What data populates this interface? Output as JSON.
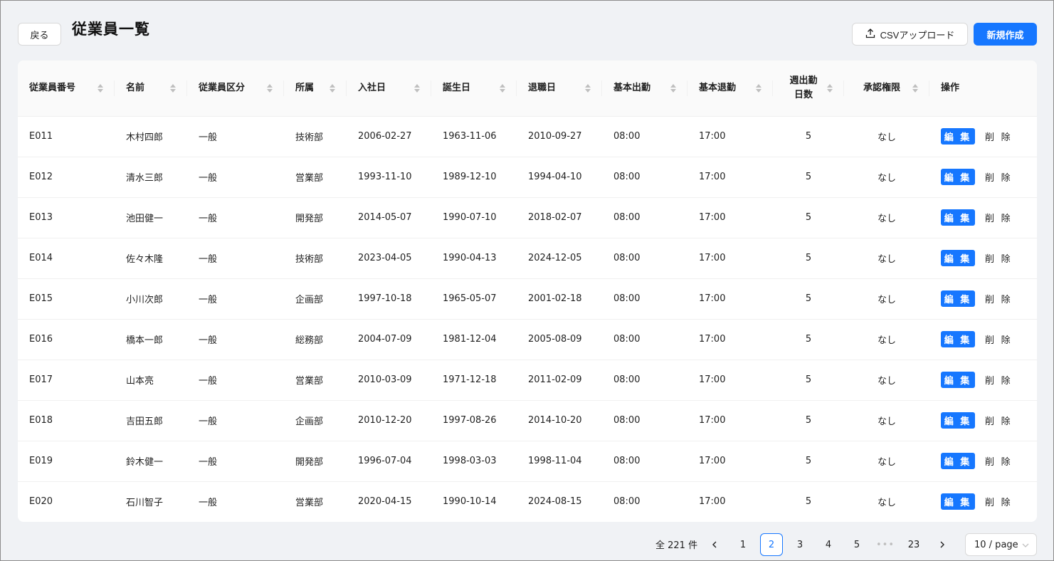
{
  "header": {
    "back_label": "戻る",
    "title": "従業員一覧",
    "csv_upload_label": "CSVアップロード",
    "new_label": "新規作成"
  },
  "table": {
    "columns": [
      "従業員番号",
      "名前",
      "従業員区分",
      "所属",
      "入社日",
      "誕生日",
      "退職日",
      "基本出勤",
      "基本退勤",
      "週出勤\n日数",
      "承認権限",
      "操作"
    ],
    "edit_label": "編 集",
    "delete_label": "削 除",
    "rows": [
      [
        "E011",
        "木村四郎",
        "一般",
        "技術部",
        "2006-02-27",
        "1963-11-06",
        "2010-09-27",
        "08:00",
        "17:00",
        "5",
        "なし"
      ],
      [
        "E012",
        "清水三郎",
        "一般",
        "営業部",
        "1993-11-10",
        "1989-12-10",
        "1994-04-10",
        "08:00",
        "17:00",
        "5",
        "なし"
      ],
      [
        "E013",
        "池田健一",
        "一般",
        "開発部",
        "2014-05-07",
        "1990-07-10",
        "2018-02-07",
        "08:00",
        "17:00",
        "5",
        "なし"
      ],
      [
        "E014",
        "佐々木隆",
        "一般",
        "技術部",
        "2023-04-05",
        "1990-04-13",
        "2024-12-05",
        "08:00",
        "17:00",
        "5",
        "なし"
      ],
      [
        "E015",
        "小川次郎",
        "一般",
        "企画部",
        "1997-10-18",
        "1965-05-07",
        "2001-02-18",
        "08:00",
        "17:00",
        "5",
        "なし"
      ],
      [
        "E016",
        "橋本一郎",
        "一般",
        "総務部",
        "2004-07-09",
        "1981-12-04",
        "2005-08-09",
        "08:00",
        "17:00",
        "5",
        "なし"
      ],
      [
        "E017",
        "山本亮",
        "一般",
        "営業部",
        "2010-03-09",
        "1971-12-18",
        "2011-02-09",
        "08:00",
        "17:00",
        "5",
        "なし"
      ],
      [
        "E018",
        "吉田五郎",
        "一般",
        "企画部",
        "2010-12-20",
        "1997-08-26",
        "2014-10-20",
        "08:00",
        "17:00",
        "5",
        "なし"
      ],
      [
        "E019",
        "鈴木健一",
        "一般",
        "開発部",
        "1996-07-04",
        "1998-03-03",
        "1998-11-04",
        "08:00",
        "17:00",
        "5",
        "なし"
      ],
      [
        "E020",
        "石川智子",
        "一般",
        "営業部",
        "2020-04-15",
        "1990-10-14",
        "2024-08-15",
        "08:00",
        "17:00",
        "5",
        "なし"
      ]
    ]
  },
  "pagination": {
    "total_label": "全 221 件",
    "pages": [
      "1",
      "2",
      "3",
      "4",
      "5",
      "•••",
      "23"
    ],
    "current_page": "2",
    "page_size_label": "10 / page"
  },
  "colors": {
    "primary": "#1677ff",
    "background": "#f0f2f5"
  }
}
